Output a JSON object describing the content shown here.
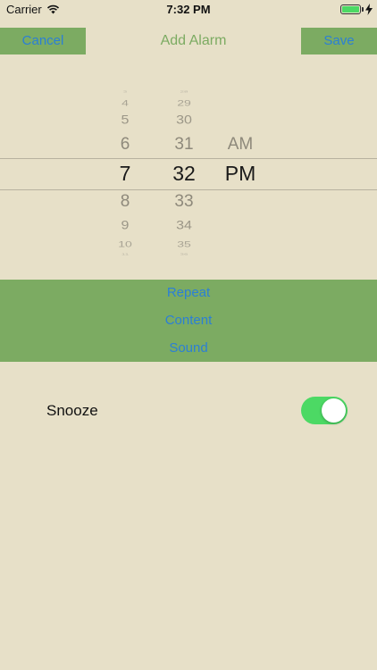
{
  "status_bar": {
    "carrier": "Carrier",
    "time": "7:32 PM",
    "wifi_icon": "wifi-icon",
    "battery_icon": "battery-full-icon",
    "charging_icon": "bolt-icon"
  },
  "nav": {
    "cancel_label": "Cancel",
    "title": "Add Alarm",
    "save_label": "Save"
  },
  "picker": {
    "hours": [
      "3",
      "4",
      "5",
      "6",
      "7",
      "8",
      "9",
      "10",
      "11"
    ],
    "minutes": [
      "28",
      "29",
      "30",
      "31",
      "32",
      "33",
      "34",
      "35",
      "36"
    ],
    "periods": [
      "AM",
      "PM"
    ],
    "selected_hour": "7",
    "selected_minute": "32",
    "selected_period": "PM"
  },
  "options": {
    "repeat_label": "Repeat",
    "content_label": "Content",
    "sound_label": "Sound"
  },
  "snooze": {
    "label": "Snooze",
    "enabled": true
  },
  "colors": {
    "background": "#e7e0c8",
    "accent_green": "#7cab62",
    "link_blue": "#2b7fd6",
    "toggle_on": "#4cd964"
  }
}
